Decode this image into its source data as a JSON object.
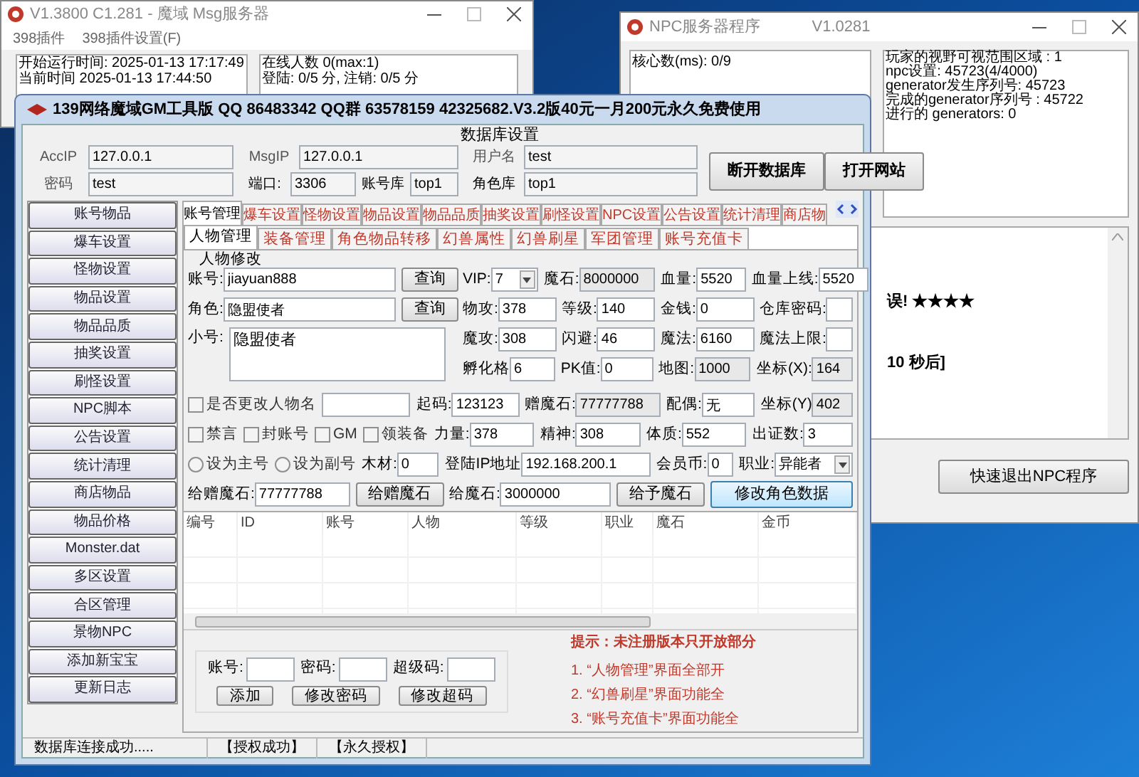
{
  "msg_window": {
    "title": "V1.3800 C1.281  - 魔域  Msg服务器",
    "menu": [
      "398插件",
      "398插件设置(F)"
    ],
    "left_lines": [
      "开始运行时间: 2025-01-13 17:17:49",
      "当前时间 2025-01-13 17:44:50"
    ],
    "right_lines": [
      "在线人数   0(max:1)",
      "登陆:  0/5 分, 注销:   0/5 分"
    ]
  },
  "npc_window": {
    "title": "NPC服务器程序",
    "version": "V1.0281",
    "core": "核心数(ms): 0/9",
    "info_lines": [
      "玩家的视野可视范围区域   : 1",
      "npc设置: 45723(4/4000)",
      "generator发生序列号: 45723",
      "完成的generator序列号 : 45722",
      "进行的 generators: 0"
    ],
    "log_lines": [
      "误! ★★★★",
      "10 秒后]"
    ],
    "exit_button": "快速退出NPC程序"
  },
  "gm_window": {
    "title": "139网络魔域GM工具版 QQ 86483342 QQ群 63578159 42325682.V3.2版40元一月200元永久免费使用",
    "db": {
      "title": "数据库设置",
      "fields": [
        {
          "label": "AccIP",
          "value": "127.0.0.1"
        },
        {
          "label": "MsgIP",
          "value": "127.0.0.1"
        },
        {
          "label": "用户名",
          "value": "test"
        },
        {
          "label": "密码",
          "value": "test"
        },
        {
          "label": "端口:",
          "value": "3306"
        },
        {
          "label": "账号库",
          "value": "top1"
        },
        {
          "label": "角色库",
          "value": "top1"
        }
      ],
      "buttons": [
        "断开数据库",
        "打开网站"
      ]
    },
    "sidebar": [
      "账号物品",
      "爆车设置",
      "怪物设置",
      "物品设置",
      "物品品质",
      "抽奖设置",
      "刷怪设置",
      "NPC脚本",
      "公告设置",
      "统计清理",
      "商店物品",
      "物品价格",
      "Monster.dat",
      "多区设置",
      "合区管理",
      "景物NPC",
      "添加新宝宝",
      "更新日志"
    ],
    "tabs": [
      {
        "label": "账号管理",
        "selected": true
      },
      {
        "label": "爆车设置",
        "selected": false
      },
      {
        "label": "怪物设置",
        "selected": false
      },
      {
        "label": "物品设置",
        "selected": false
      },
      {
        "label": "物品品质",
        "selected": false
      },
      {
        "label": "抽奖设置",
        "selected": false
      },
      {
        "label": "刷怪设置",
        "selected": false
      },
      {
        "label": "NPC设置",
        "selected": false
      },
      {
        "label": "公告设置",
        "selected": false
      },
      {
        "label": "统计清理",
        "selected": false
      },
      {
        "label": "商店物",
        "selected": false
      }
    ],
    "subtabs": [
      {
        "label": "人物管理",
        "selected": true
      },
      {
        "label": "装备管理",
        "selected": false
      },
      {
        "label": "角色物品转移",
        "selected": false
      },
      {
        "label": "幻兽属性",
        "selected": false
      },
      {
        "label": "幻兽刷星",
        "selected": false
      },
      {
        "label": "军团管理",
        "selected": false
      },
      {
        "label": "账号充值卡",
        "selected": false
      }
    ],
    "form_title": "人物修改",
    "form_rows": [
      [
        {
          "kind": "field",
          "label": "账号:",
          "value": "jiayuan888",
          "disabled": false
        },
        {
          "kind": "button",
          "label": "查询"
        },
        {
          "kind": "select",
          "label": "VIP:",
          "value": "7"
        },
        {
          "kind": "field",
          "label": "魔石:",
          "value": "8000000",
          "disabled": true
        },
        {
          "kind": "field",
          "label": "血量:",
          "value": "5520",
          "disabled": false
        },
        {
          "kind": "field",
          "label": "血量上线:",
          "value": "5520",
          "disabled": false
        }
      ],
      [
        {
          "kind": "field",
          "label": "角色:",
          "value": "隐盟使者",
          "disabled": false
        },
        {
          "kind": "button",
          "label": "查询"
        },
        {
          "kind": "field",
          "label": "物攻:",
          "value": "378",
          "disabled": false
        },
        {
          "kind": "field",
          "label": "等级:",
          "value": "140",
          "disabled": false
        },
        {
          "kind": "field",
          "label": "金钱:",
          "value": "0",
          "disabled": false
        },
        {
          "kind": "field",
          "label": "仓库密码:",
          "disabled": false
        }
      ],
      [
        {
          "kind": "textarea",
          "label": "小号:",
          "value": "隐盟使者"
        },
        {
          "kind": "field",
          "label": "魔攻:",
          "value": "308",
          "disabled": false
        },
        {
          "kind": "field",
          "label": "闪避:",
          "value": "46",
          "disabled": false
        },
        {
          "kind": "field",
          "label": "魔法:",
          "value": "6160",
          "disabled": false
        },
        {
          "kind": "field",
          "label": "魔法上限:",
          "disabled": false
        }
      ],
      [
        {
          "kind": "spacer"
        },
        {
          "kind": "field",
          "label": "孵化格",
          "value": "6",
          "disabled": false
        },
        {
          "kind": "field",
          "label": "PK值:",
          "value": "0",
          "disabled": false
        },
        {
          "kind": "field",
          "label": "地图:",
          "value": "1000",
          "disabled": true
        },
        {
          "kind": "field",
          "label": "坐标(X):",
          "value": "164",
          "disabled": true
        }
      ],
      [
        {
          "kind": "checkbox",
          "label": "是否更改人物名",
          "checked": false
        },
        {
          "kind": "field",
          "disabled": false
        },
        {
          "kind": "field",
          "label": "起码:",
          "value": "123123",
          "disabled": false
        },
        {
          "kind": "field",
          "label": "赠魔石:",
          "value": "77777788",
          "disabled": true
        },
        {
          "kind": "field",
          "label": "配偶:",
          "value": "无",
          "disabled": false
        },
        {
          "kind": "field",
          "label": "坐标(Y)",
          "value": "402",
          "disabled": true
        }
      ],
      [
        {
          "kind": "checkbox",
          "label": "禁言",
          "checked": false
        },
        {
          "kind": "checkbox",
          "label": "封账号",
          "checked": false
        },
        {
          "kind": "checkbox",
          "label": "GM",
          "checked": false
        },
        {
          "kind": "checkbox",
          "label": "领装备",
          "checked": false
        },
        {
          "kind": "field",
          "label": "力量:",
          "value": "378",
          "disabled": false
        },
        {
          "kind": "field",
          "label": "精神:",
          "value": "308",
          "disabled": false
        },
        {
          "kind": "field",
          "label": "体质:",
          "value": "552",
          "disabled": false
        },
        {
          "kind": "field",
          "label": "出证数:",
          "value": "3",
          "disabled": false
        }
      ],
      [
        {
          "kind": "radio",
          "label": "设为主号",
          "selected": false
        },
        {
          "kind": "radio",
          "label": "设为副号",
          "selected": false
        },
        {
          "kind": "field",
          "label": "木材:",
          "value": "0",
          "disabled": false
        },
        {
          "kind": "field",
          "label": "登陆IP地址",
          "value": "192.168.200.1",
          "disabled": false
        },
        {
          "kind": "field",
          "label": "会员币:",
          "value": "0",
          "disabled": false
        },
        {
          "kind": "select",
          "label": "职业:",
          "value": "异能者"
        }
      ],
      [
        {
          "kind": "field",
          "label": "给赠魔石:",
          "value": "77777788",
          "disabled": false
        },
        {
          "kind": "button",
          "label": "给赠魔石"
        },
        {
          "kind": "field",
          "label": "给魔石:",
          "value": "3000000",
          "disabled": false
        },
        {
          "kind": "button",
          "label": "给予魔石"
        },
        {
          "kind": "primary",
          "label": "修改角色数据"
        }
      ]
    ],
    "table": {
      "columns": [
        "编号",
        "ID",
        "账号",
        "人物",
        "等级",
        "职业",
        "魔石",
        "金币"
      ]
    },
    "account": {
      "fields": [
        "账号:",
        "密码:",
        "超级码:"
      ],
      "buttons": [
        "添加",
        "修改密码",
        "修改超码"
      ]
    },
    "notes": [
      "提示：未注册版本只开放部分",
      "1. “人物管理”界面全部开",
      "2. “幻兽刷星”界面功能全",
      "3. “账号充值卡”界面功能全"
    ],
    "status_bar": [
      "数据库连接成功.....",
      "【授权成功】",
      "【永久授权】"
    ]
  }
}
